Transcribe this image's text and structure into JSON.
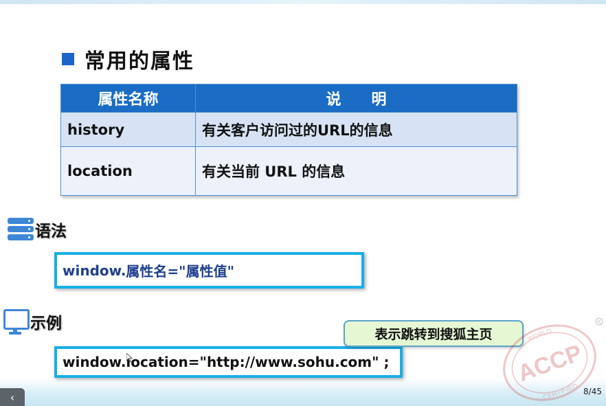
{
  "slide": {
    "title": "常用的属性",
    "page_indicator": "8/45"
  },
  "table": {
    "headers": [
      "属性名称",
      "说　　明"
    ],
    "rows": [
      [
        "history",
        "有关客户访问过的URL的信息"
      ],
      [
        "location",
        "有关当前 URL 的信息"
      ]
    ]
  },
  "syntax": {
    "label": "语法",
    "code_prefix": "window.",
    "code_rest": "属性名=\"属性值\""
  },
  "example": {
    "label": "示例",
    "code": "window.location=\"http://www.sohu.com\" ;",
    "callout": "表示跳转到搜狐主页"
  },
  "watermark": {
    "text": "ACCP",
    "ring_top": "WORLD",
    "ring_bottom": "CERTIFIED"
  },
  "colors": {
    "bullet": "#1d64c7",
    "table_header": "#1a6cc4",
    "code_border": "#16b0e6",
    "callout_bg": "#e6f7d4",
    "syntax_code_color": "#1f3f8f"
  },
  "icons": {
    "syntax": "server-stack-icon",
    "example": "monitor-icon",
    "nav": "chevron-left-icon"
  }
}
